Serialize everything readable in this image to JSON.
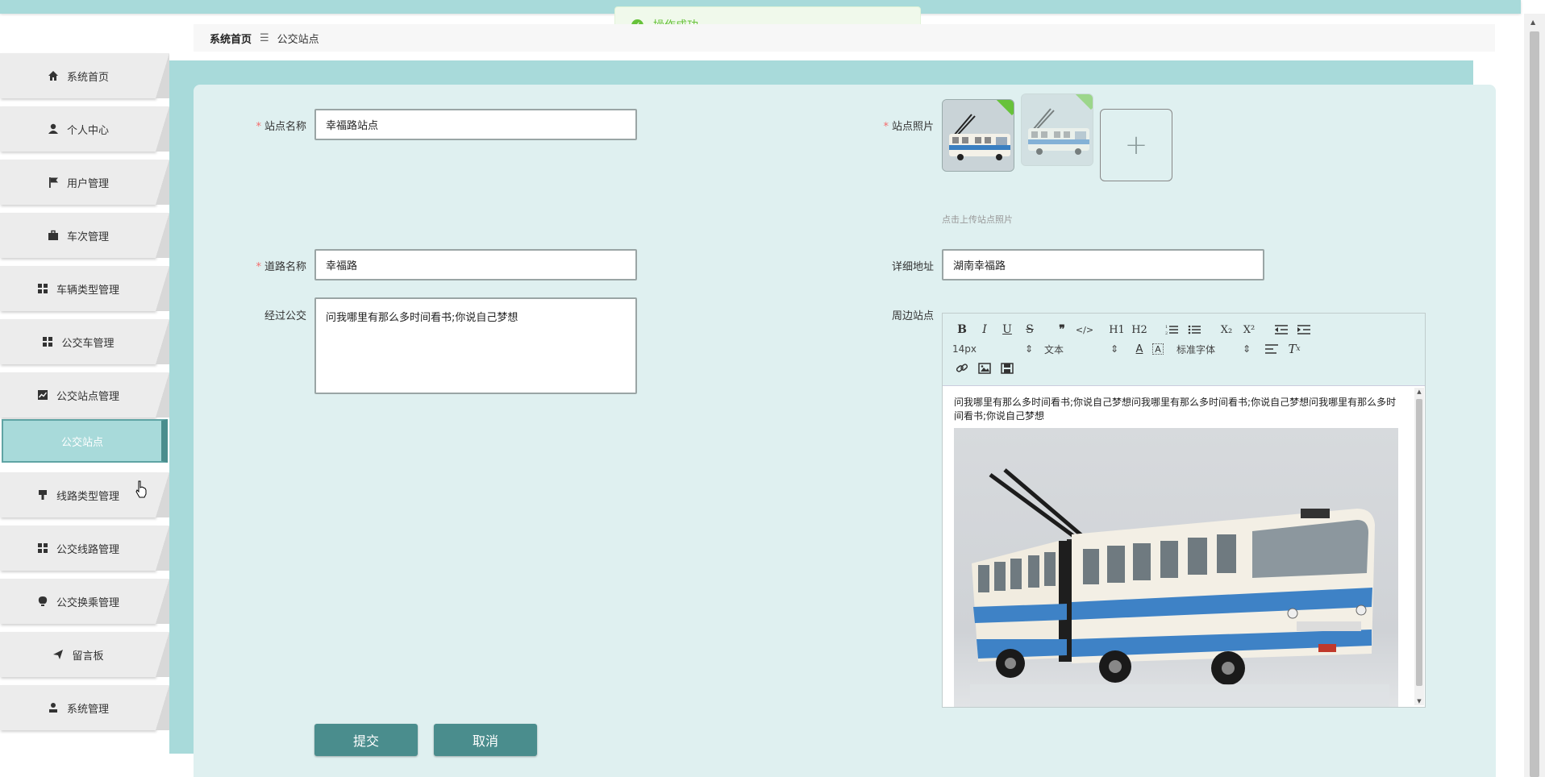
{
  "toast": {
    "icon": "success-check-icon",
    "text": "操作成功",
    "color": "#67c23a"
  },
  "breadcrumb": {
    "home": "系统首页",
    "separator": "☰",
    "current": "公交站点"
  },
  "sidebar": {
    "items": [
      {
        "label": "系统首页",
        "icon": "home-icon"
      },
      {
        "label": "个人中心",
        "icon": "user-icon"
      },
      {
        "label": "用户管理",
        "icon": "flag-icon"
      },
      {
        "label": "车次管理",
        "icon": "briefcase-icon"
      },
      {
        "label": "车辆类型管理",
        "icon": "grid-icon"
      },
      {
        "label": "公交车管理",
        "icon": "grid-icon"
      },
      {
        "label": "公交站点管理",
        "icon": "chart-icon"
      },
      {
        "label": "线路类型管理",
        "icon": "brush-icon"
      },
      {
        "label": "公交线路管理",
        "icon": "grid-icon"
      },
      {
        "label": "公交换乘管理",
        "icon": "bulb-icon"
      },
      {
        "label": "留言板",
        "icon": "send-icon"
      },
      {
        "label": "系统管理",
        "icon": "admin-icon"
      }
    ],
    "active_sub_item": "公交站点"
  },
  "form": {
    "station_name": {
      "label": "站点名称",
      "required": true,
      "value": "幸福路站点"
    },
    "station_photo": {
      "label": "站点照片",
      "required": true,
      "hint": "点击上传站点照片",
      "upload_icon": "plus-icon"
    },
    "road_name": {
      "label": "道路名称",
      "required": true,
      "value": "幸福路"
    },
    "address": {
      "label": "详细地址",
      "required": false,
      "value": "湖南幸福路"
    },
    "passing_bus": {
      "label": "经过公交",
      "required": false,
      "value": "问我哪里有那么多时间看书;你说自己梦想"
    },
    "nearby": {
      "label": "周边站点",
      "required": false,
      "toolbar": {
        "row1": [
          "B",
          "I",
          "U",
          "S",
          "❞",
          "</>",
          "H1",
          "H2",
          "ordered-list",
          "unordered-list",
          "X₂",
          "X²",
          "outdent",
          "indent"
        ],
        "size": "14px",
        "header": "文本",
        "font": "标准字体"
      },
      "content": "问我哪里有那么多时间看书;你说自己梦想问我哪里有那么多时间看书;你说自己梦想问我哪里有那么多时间看书;你说自己梦想",
      "image_alt": "articulated-trolleybus-photo"
    }
  },
  "buttons": {
    "submit": "提交",
    "cancel": "取消"
  },
  "colors": {
    "teal": "#a8dada",
    "dark_teal": "#4a8d8d",
    "panel": "#dff0f0"
  }
}
